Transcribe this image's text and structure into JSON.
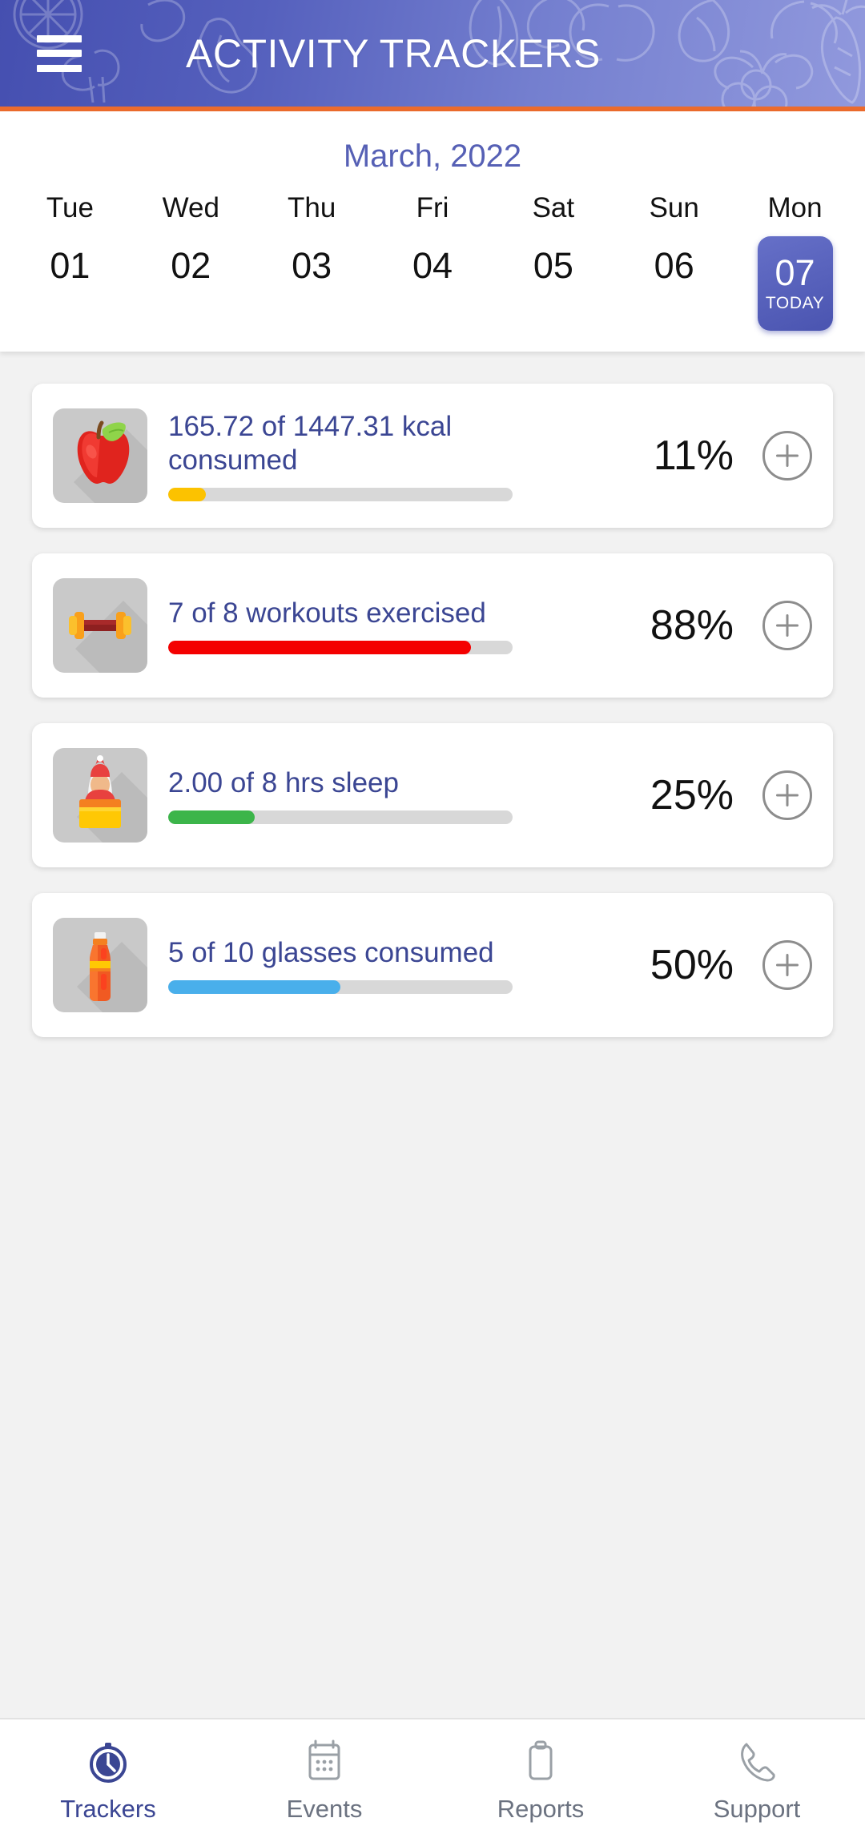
{
  "header": {
    "title": "ACTIVITY TRACKERS",
    "menu_icon": "hamburger-menu-icon",
    "accent_rule_color": "#ec6b2d",
    "gradient_from": "#454fb0",
    "gradient_to": "#9199dd",
    "decorations": [
      "orange-slice-outline",
      "banana-outline",
      "broccoli-outline",
      "apple-outline",
      "leaf-outline",
      "berries-outline",
      "carrot-outline"
    ]
  },
  "calendar": {
    "month_label": "March, 2022",
    "today_tag": "TODAY",
    "days": [
      {
        "dow": "Tue",
        "num": "01",
        "today": false
      },
      {
        "dow": "Wed",
        "num": "02",
        "today": false
      },
      {
        "dow": "Thu",
        "num": "03",
        "today": false
      },
      {
        "dow": "Fri",
        "num": "04",
        "today": false
      },
      {
        "dow": "Sat",
        "num": "05",
        "today": false
      },
      {
        "dow": "Sun",
        "num": "06",
        "today": false
      },
      {
        "dow": "Mon",
        "num": "07",
        "today": true
      }
    ]
  },
  "trackers": [
    {
      "icon": "apple-icon",
      "label": "165.72 of 1447.31 kcal consumed",
      "percent_label": "11%",
      "percent": 11,
      "bar_color": "#fcc200",
      "add_label": "+",
      "current": 165.72,
      "goal": 1447.31,
      "unit": "kcal"
    },
    {
      "icon": "dumbbell-icon",
      "label": "7 of 8 workouts exercised",
      "percent_label": "88%",
      "percent": 88,
      "bar_color": "#f40000",
      "add_label": "+",
      "current": 7,
      "goal": 8,
      "unit": "workouts"
    },
    {
      "icon": "sleep-bed-icon",
      "label": "2.00 of 8 hrs sleep",
      "percent_label": "25%",
      "percent": 25,
      "bar_color": "#3cb54a",
      "add_label": "+",
      "current": 2.0,
      "goal": 8,
      "unit": "hrs"
    },
    {
      "icon": "water-bottle-icon",
      "label": "5 of 10 glasses consumed",
      "percent_label": "50%",
      "percent": 50,
      "bar_color": "#49afeb",
      "add_label": "+",
      "current": 5,
      "goal": 10,
      "unit": "glasses"
    }
  ],
  "bottom_nav": {
    "active_color": "#3b4693",
    "inactive_color": "#6b7280",
    "items": [
      {
        "label": "Trackers",
        "icon": "stopwatch-icon",
        "active": true
      },
      {
        "label": "Events",
        "icon": "calendar-icon",
        "active": false
      },
      {
        "label": "Reports",
        "icon": "clipboard-icon",
        "active": false
      },
      {
        "label": "Support",
        "icon": "phone-icon",
        "active": false
      }
    ]
  }
}
